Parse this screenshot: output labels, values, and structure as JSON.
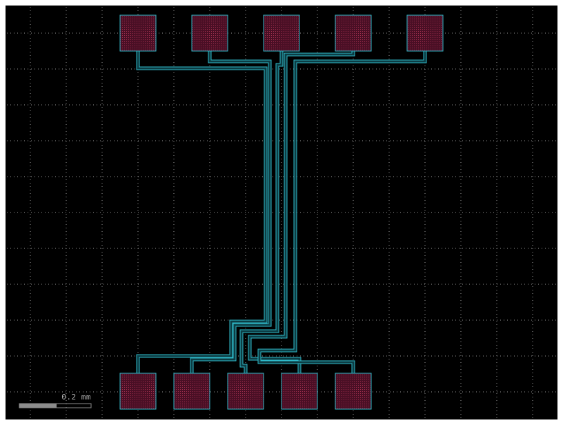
{
  "viewer": {
    "colors": {
      "background": "#000000",
      "frame": "#ffffff",
      "grid": "#9a9a9a",
      "pad_fill": "#4a0f25",
      "pad_hatch": "#a0304e",
      "pad_outline": "#2fb9c9",
      "route": "#2fb9c9",
      "route_fill": "#0c3d44",
      "scale_bar": "#8c8c8c",
      "scale_text": "#b4b4b4"
    }
  },
  "scale_bar": {
    "label": "0.2 mm"
  },
  "layout": {
    "pad_count": 10,
    "top_pad_count": 5,
    "bottom_pad_count": 5,
    "route_count": 5
  }
}
